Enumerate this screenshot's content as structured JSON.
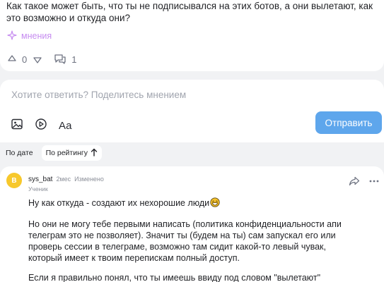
{
  "question": {
    "text": "Как такое может быть, что ты не подписывался на этих ботов, а они вылетают, как это возможно и откуда они?",
    "mneniya_label": "мнения",
    "vote_count": "0",
    "comment_count": "1"
  },
  "reply": {
    "placeholder": "Хотите ответить? Поделитесь мнением",
    "format_label": "Аа",
    "send_label": "Отправить"
  },
  "sort": {
    "by_date": "По дате",
    "by_rating": "По рейтингу"
  },
  "answer": {
    "avatar_letter": "В",
    "author": "sys_bat",
    "time": "2мес",
    "edited": "Изменено",
    "rank": "Ученик",
    "paragraphs": [
      "Ну как откуда - создают их нехорошие люди",
      "Но они не могу тебе первыми написать (политика конфиденциальности апи телеграм это не позволяет). Значит ты (будем на ты) сам запускал его или проверь сессии в телеграме, возможно там сидит какой-то левый чувак, который имеет к твоим перепискам полный доступ.",
      "Если я правильно понял, что ты имеешь ввиду под словом \"вылетают\""
    ]
  },
  "colors": {
    "accent": "#5ea6ec",
    "mneniya": "#c68cf0",
    "avatar": "#f7c82c",
    "page_bg": "#f1f2f4"
  },
  "icons": [
    "sparkle-icon",
    "arrow-up-icon",
    "arrow-down-icon",
    "comment-icon",
    "image-icon",
    "play-icon",
    "share-icon",
    "more-dots-icon",
    "arrow-up-sort-icon",
    "grinning-emoji"
  ]
}
